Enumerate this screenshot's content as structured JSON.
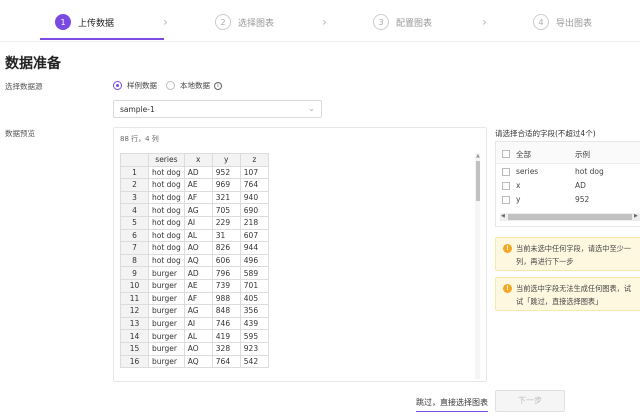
{
  "steps": [
    {
      "num": "1",
      "label": "上传数据"
    },
    {
      "num": "2",
      "label": "选择图表"
    },
    {
      "num": "3",
      "label": "配置图表"
    },
    {
      "num": "4",
      "label": "导出图表"
    }
  ],
  "page_title": "数据准备",
  "source": {
    "label": "选择数据源",
    "options": [
      "样例数据",
      "本地数据"
    ],
    "selected": "sample-1"
  },
  "preview": {
    "label": "数据预览",
    "meta": "88 行，4 列",
    "columns": [
      "series",
      "x",
      "y",
      "z"
    ],
    "rows": [
      [
        "1",
        "hot dog",
        "AD",
        "952",
        "107"
      ],
      [
        "2",
        "hot dog",
        "AE",
        "969",
        "764"
      ],
      [
        "3",
        "hot dog",
        "AF",
        "321",
        "940"
      ],
      [
        "4",
        "hot dog",
        "AG",
        "705",
        "690"
      ],
      [
        "5",
        "hot dog",
        "AI",
        "229",
        "218"
      ],
      [
        "6",
        "hot dog",
        "AL",
        "31",
        "607"
      ],
      [
        "7",
        "hot dog",
        "AO",
        "826",
        "944"
      ],
      [
        "8",
        "hot dog",
        "AQ",
        "606",
        "496"
      ],
      [
        "9",
        "burger",
        "AD",
        "796",
        "589"
      ],
      [
        "10",
        "burger",
        "AE",
        "739",
        "701"
      ],
      [
        "11",
        "burger",
        "AF",
        "988",
        "405"
      ],
      [
        "12",
        "burger",
        "AG",
        "848",
        "356"
      ],
      [
        "13",
        "burger",
        "AI",
        "746",
        "439"
      ],
      [
        "14",
        "burger",
        "AL",
        "419",
        "595"
      ],
      [
        "15",
        "burger",
        "AO",
        "328",
        "923"
      ],
      [
        "16",
        "burger",
        "AQ",
        "764",
        "542"
      ]
    ]
  },
  "fields": {
    "title": "请选择合适的字段(不超过4个)",
    "header": {
      "all": "全部",
      "example": "示例"
    },
    "items": [
      {
        "name": "series",
        "example": "hot dog"
      },
      {
        "name": "x",
        "example": "AD"
      },
      {
        "name": "y",
        "example": "952"
      }
    ]
  },
  "alerts": [
    {
      "lines": [
        "当前未选中任何字段，请选中至少一",
        "列，再进行下一步"
      ]
    },
    {
      "lines": [
        "当前选中字段无法生成任何图表，试",
        "试「跳过，直接选择图表」"
      ]
    }
  ],
  "footer": {
    "skip": "跳过，直接选择图表",
    "next": "下一步"
  },
  "colors": {
    "accent": "#7b4ae2",
    "warning": "#f5a623"
  }
}
